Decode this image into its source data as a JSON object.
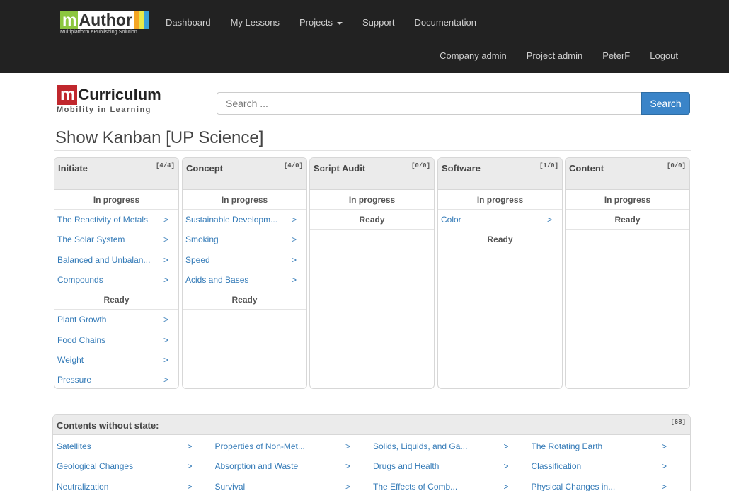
{
  "brand": {
    "m": "m",
    "rest": "Author",
    "subtitle": "Multiplatform ePublishing Solution",
    "bar_colors": [
      "#8cc63f",
      "#f5a623",
      "#e8e84a",
      "#3aa0d8"
    ]
  },
  "nav": {
    "top": [
      "Dashboard",
      "My Lessons",
      "Projects",
      "Support",
      "Documentation"
    ],
    "right": [
      "Company admin",
      "Project admin",
      "PeterF",
      "Logout"
    ]
  },
  "logo2": {
    "m": "m",
    "rest": "Curriculum",
    "subtitle": "Mobility in Learning"
  },
  "search": {
    "placeholder": "Search ...",
    "button": "Search"
  },
  "page_title": "Show Kanban [UP Science]",
  "kanban": [
    {
      "title": "Initiate",
      "count": "[4/4]",
      "in_progress_label": "In progress",
      "in_progress": [
        "The Reactivity of Metals",
        "The Solar System",
        "Balanced and Unbalan...",
        "Compounds"
      ],
      "ready_label": "Ready",
      "ready": [
        "Plant Growth",
        "Food Chains",
        "Weight",
        "Pressure"
      ]
    },
    {
      "title": "Concept",
      "count": "[4/0]",
      "in_progress_label": "In progress",
      "in_progress": [
        "Sustainable Developm...",
        "Smoking",
        "Speed",
        "Acids and Bases"
      ],
      "ready_label": "Ready",
      "ready": []
    },
    {
      "title": "Script Audit",
      "count": "[0/0]",
      "in_progress_label": "In progress",
      "in_progress": [],
      "ready_label": "Ready",
      "ready": []
    },
    {
      "title": "Software",
      "count": "[1/0]",
      "in_progress_label": "In progress",
      "in_progress": [
        "Color"
      ],
      "ready_label": "Ready",
      "ready": []
    },
    {
      "title": "Content",
      "count": "[0/0]",
      "in_progress_label": "In progress",
      "in_progress": [],
      "ready_label": "Ready",
      "ready": []
    }
  ],
  "arrow": ">",
  "contents_without_state": {
    "title": "Contents without state:",
    "count": "[68]",
    "items": [
      "Satellites",
      "Properties of Non-Met...",
      "Solids, Liquids, and Ga...",
      "The Rotating Earth",
      "Geological Changes",
      "Absorption and Waste",
      "Drugs and Health",
      "Classification",
      "Neutralization",
      "Survival",
      "The Effects of Comb...",
      "Physical Changes in..."
    ]
  }
}
